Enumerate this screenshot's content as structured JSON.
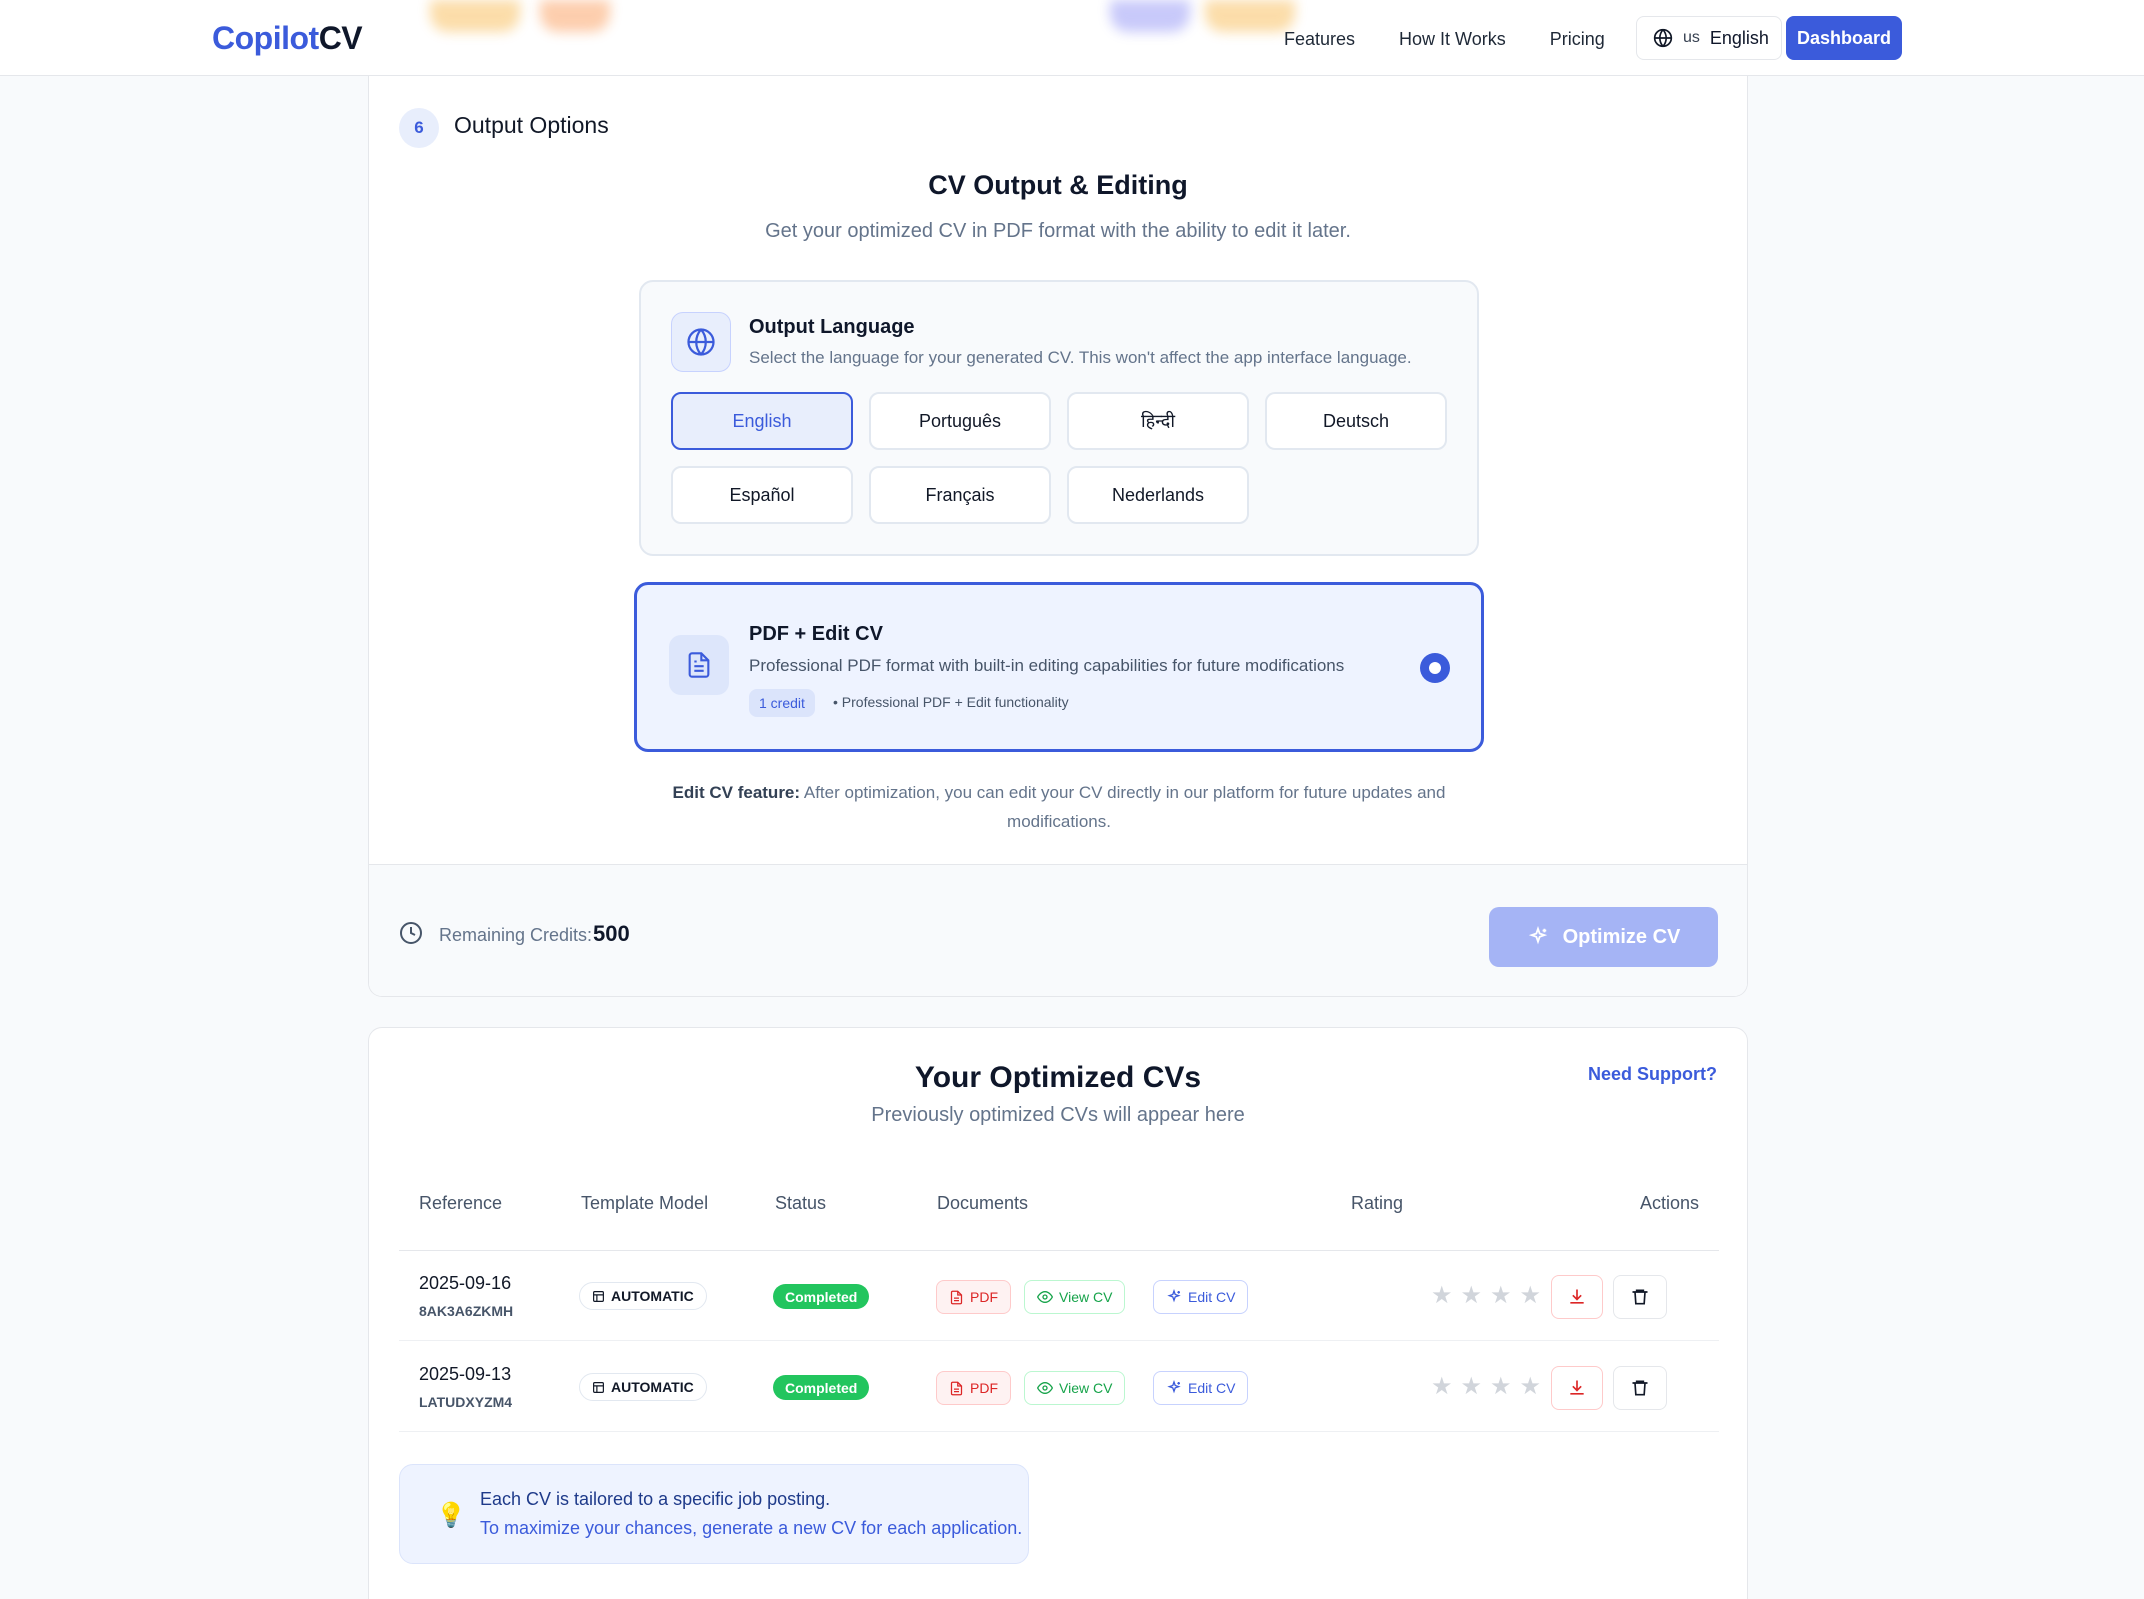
{
  "header": {
    "logo_part1": "Copilot",
    "logo_part2": "CV",
    "nav": [
      "Features",
      "How It Works",
      "Pricing"
    ],
    "lang_country": "us",
    "lang_label": "English",
    "dashboard_label": "Dashboard"
  },
  "output": {
    "step_number": "6",
    "step_title": "Output Options",
    "title": "CV Output & Editing",
    "subtitle": "Get your optimized CV in PDF format with the ability to edit it later.",
    "language": {
      "title": "Output Language",
      "description": "Select the language for your generated CV. This won't affect the app interface language.",
      "options": [
        "English",
        "Português",
        "हिन्दी",
        "Deutsch",
        "Español",
        "Français",
        "Nederlands"
      ],
      "selected": "English"
    },
    "pdf_option": {
      "title": "PDF + Edit CV",
      "description": "Professional PDF format with built-in editing capabilities for future modifications",
      "credit": "1 credit",
      "extra": "• Professional PDF + Edit functionality"
    },
    "edit_note_bold": "Edit CV feature:",
    "edit_note": "After optimization, you can edit your CV directly in our platform for future updates and modifications.",
    "credits_label": "Remaining Credits:",
    "credits_value": "500",
    "optimize_label": "Optimize CV"
  },
  "cvs": {
    "title": "Your Optimized CVs",
    "subtitle": "Previously optimized CVs will appear here",
    "support_label": "Need Support?",
    "columns": [
      "Reference",
      "Template Model",
      "Status",
      "Documents",
      "Rating",
      "Actions"
    ],
    "rows": [
      {
        "date": "2025-09-16",
        "code": "8AK3A6ZKMH",
        "template": "AUTOMATIC",
        "status": "Completed",
        "pdf": "PDF",
        "view": "View CV",
        "edit": "Edit CV",
        "rating": 0
      },
      {
        "date": "2025-09-13",
        "code": "LATUDXYZM4",
        "template": "AUTOMATIC",
        "status": "Completed",
        "pdf": "PDF",
        "view": "View CV",
        "edit": "Edit CV",
        "rating": 0
      }
    ],
    "tip_line1": "Each CV is tailored to a specific job posting.",
    "tip_line2": "To maximize your chances, generate a new CV for each application."
  },
  "colors": {
    "accent": "#3b5bdb",
    "success": "#22c55e",
    "danger": "#dc2626"
  }
}
